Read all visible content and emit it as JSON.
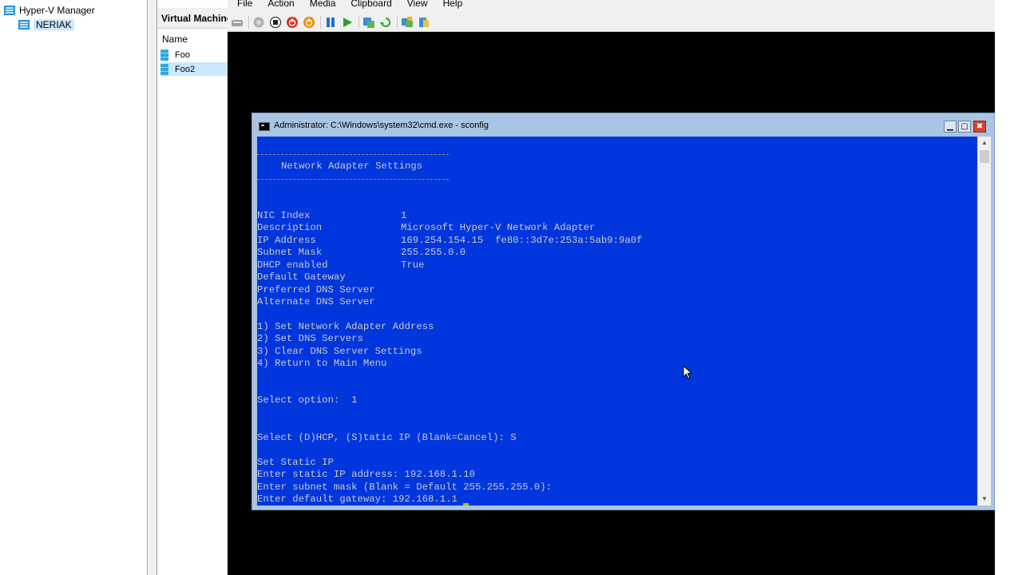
{
  "tree": {
    "root_label": "Hyper-V Manager",
    "server_label": "NERIAK"
  },
  "vm_list": {
    "header": "Virtual Machines",
    "column_name": "Name",
    "rows": [
      "Foo",
      "Foo2"
    ]
  },
  "vmconnect": {
    "menu": [
      "File",
      "Action",
      "Media",
      "Clipboard",
      "View",
      "Help"
    ],
    "toolbar_icons": [
      "ctrl-alt-del-icon",
      "start-icon",
      "turn-off-icon",
      "shut-down-icon",
      "save-icon",
      "pause-icon",
      "resume-icon",
      "checkpoint-icon",
      "revert-icon",
      "share-icon",
      "enhanced-session-icon"
    ]
  },
  "cmd": {
    "title": "Administrator: C:\\Windows\\system32\\cmd.exe - sconfig",
    "heading": "Network Adapter Settings",
    "settings": [
      {
        "label": "NIC Index",
        "value": "1"
      },
      {
        "label": "Description",
        "value": "Microsoft Hyper-V Network Adapter"
      },
      {
        "label": "IP Address",
        "value": "169.254.154.15  fe80::3d7e:253a:5ab9:9a0f"
      },
      {
        "label": "Subnet Mask",
        "value": "255.255.0.0"
      },
      {
        "label": "DHCP enabled",
        "value": "True"
      },
      {
        "label": "Default Gateway",
        "value": ""
      },
      {
        "label": "Preferred DNS Server",
        "value": ""
      },
      {
        "label": "Alternate DNS Server",
        "value": ""
      }
    ],
    "options": [
      "1) Set Network Adapter Address",
      "2) Set DNS Servers",
      "3) Clear DNS Server Settings",
      "4) Return to Main Menu"
    ],
    "select_option": "Select option:  1",
    "select_mode": "Select (D)HCP, (S)tatic IP (Blank=Cancel): S",
    "static_lines": [
      "Set Static IP",
      "Enter static IP address: 192.168.1.10",
      "Enter subnet mask (Blank = Default 255.255.255.0):",
      "Enter default gateway: 192.168.1.1"
    ]
  }
}
